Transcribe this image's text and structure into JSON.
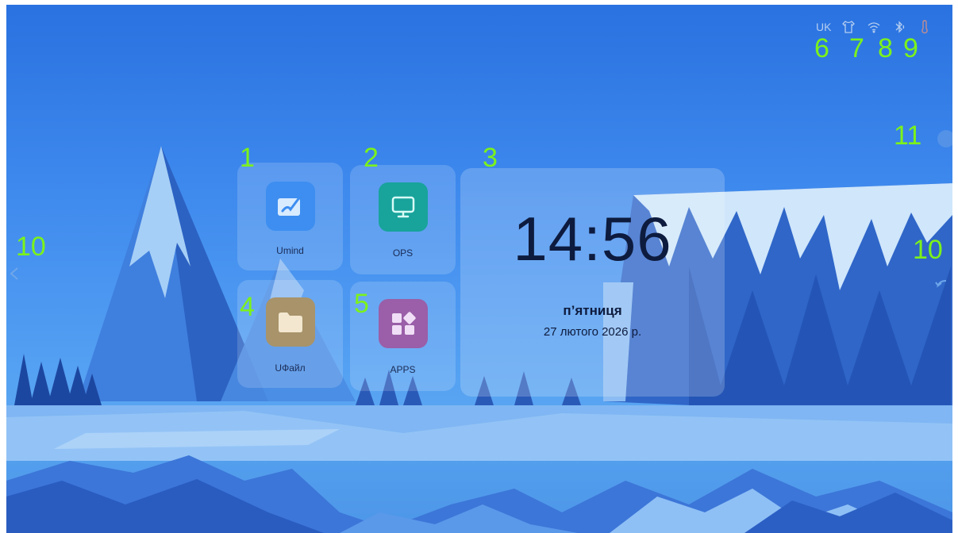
{
  "status_bar": {
    "language": "UK",
    "icons": [
      "tshirt-icon",
      "wifi-icon",
      "bluetooth-icon",
      "thermometer-icon"
    ]
  },
  "tiles": [
    {
      "id": "umind",
      "label": "Umind",
      "icon": "whiteboard-pen-icon",
      "color": "#3d8ef0"
    },
    {
      "id": "ops",
      "label": "OPS",
      "icon": "monitor-icon",
      "color": "#18a39b"
    },
    {
      "id": "ufile",
      "label": "UФайл",
      "icon": "folder-icon",
      "color": "#a8936a"
    },
    {
      "id": "apps",
      "label": "APPS",
      "icon": "apps-grid-icon",
      "color": "#9a5fa8"
    }
  ],
  "clock": {
    "time": "14:56",
    "day": "п’ятниця",
    "date": "27 лютого 2026 р."
  },
  "annotations": {
    "n1": "1",
    "n2": "2",
    "n3": "3",
    "n4": "4",
    "n5": "5",
    "n6": "6",
    "n7": "7",
    "n8": "8",
    "n9": "9",
    "n10_left": "10",
    "n10_right": "10",
    "n11": "11"
  },
  "colors": {
    "annotation": "#7cf21a",
    "clock_text": "#0d1b3e",
    "sky_top": "#2a72e0"
  }
}
